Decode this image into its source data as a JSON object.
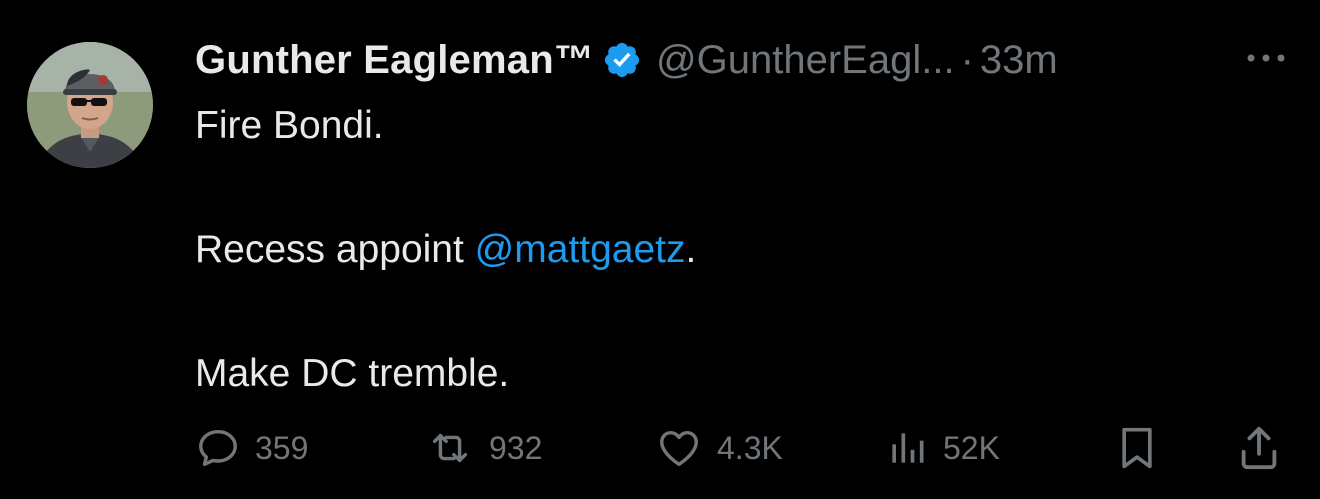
{
  "author": {
    "display_name": "Gunther Eagleman™",
    "handle": "@GuntherEagl...",
    "separator": "·",
    "timestamp": "33m",
    "verified_color": "#1d9bf0"
  },
  "body": {
    "line1": "Fire Bondi.",
    "line2_prefix": "Recess appoint ",
    "line2_mention": "@mattgaetz",
    "line2_suffix": ".",
    "line3": "Make DC tremble."
  },
  "actions": {
    "replies": "359",
    "reposts": "932",
    "likes": "4.3K",
    "views": "52K"
  },
  "icons": {
    "reply": "reply-icon",
    "repost": "repost-icon",
    "like": "heart-icon",
    "views": "views-icon",
    "bookmark": "bookmark-icon",
    "share": "share-icon",
    "more": "more-icon",
    "verified": "verified-badge-icon"
  },
  "colors": {
    "background": "#000000",
    "primary_text": "#e7e9ea",
    "secondary_text": "#71767b",
    "accent": "#1d9bf0"
  }
}
